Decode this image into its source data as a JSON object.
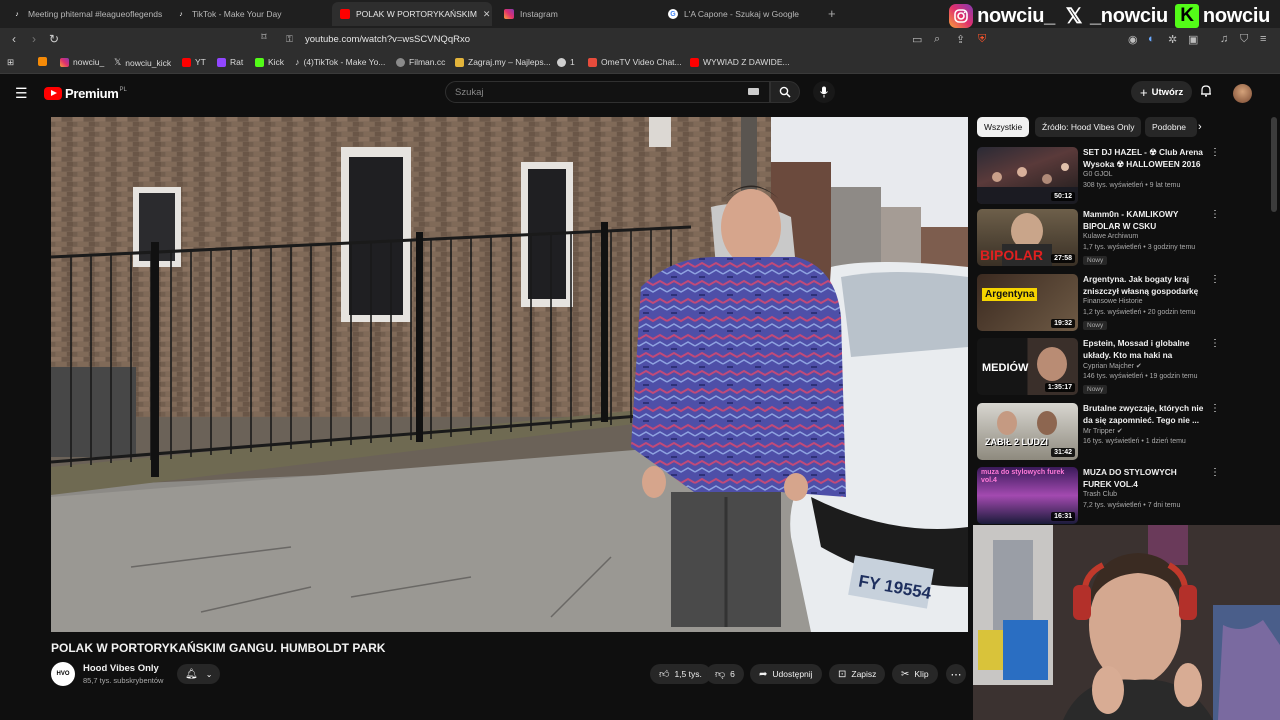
{
  "browser": {
    "tabs": [
      {
        "label": "Meeting phitemal #leagueoflegends",
        "icon": "tiktok-icon",
        "active": false
      },
      {
        "label": "TikTok - Make Your Day",
        "icon": "tiktok-icon",
        "active": false
      },
      {
        "label": "POLAK W PORTORYKAŃSKIM",
        "icon": "youtube-icon",
        "active": true
      },
      {
        "label": "Instagram",
        "icon": "instagram-icon",
        "active": false
      },
      {
        "label": "L'A Capone - Szukaj w Google",
        "icon": "google-icon",
        "active": false
      }
    ],
    "url": "youtube.com/watch?v=wsSCVNQqRxo",
    "bookmarks": [
      {
        "label": "",
        "icon": "rss-icon"
      },
      {
        "label": "nowciu_",
        "icon": "instagram-icon"
      },
      {
        "label": "nowciu_kick",
        "icon": "x-icon"
      },
      {
        "label": "YT",
        "icon": "youtube-icon"
      },
      {
        "label": "Rat",
        "icon": "twitch-icon"
      },
      {
        "label": "Kick",
        "icon": "kick-icon"
      },
      {
        "label": "(4)TikTok - Make Yo...",
        "icon": "tiktok-icon"
      },
      {
        "label": "Filman.cc",
        "icon": "globe-icon"
      },
      {
        "label": "Zagraj.my – Najleps...",
        "icon": "person-icon"
      },
      {
        "label": "1",
        "icon": "clock-icon"
      },
      {
        "label": "OmeTV Video Chat...",
        "icon": "chat-icon"
      },
      {
        "label": "WYWIAD Z DAWIDE...",
        "icon": "youtube-icon"
      }
    ]
  },
  "overlay": {
    "instagram": "nowciu_",
    "x": "_nowciu",
    "kick": "nowciu"
  },
  "youtube": {
    "logo_text": "Premium",
    "logo_region": "PL",
    "search_placeholder": "Szukaj",
    "create_label": "Utwórz",
    "video": {
      "title": "POLAK W PORTORYKAŃSKIM GANGU. HUMBOLDT PARK",
      "channel": "Hood Vibes Only",
      "subscribers": "85,7 tys. subskrybentów",
      "likes": "1,5 tys.",
      "dislikes": "6",
      "share": "Udostępnij",
      "save": "Zapisz",
      "clip": "Klip",
      "plate_text": "FY 19554"
    },
    "chips": [
      "Wszystkie",
      "Źródło: Hood Vibes Only",
      "Podobne"
    ],
    "recommendations": [
      {
        "title": "SET DJ HAZEL - ☢ Club Arena Wysoka ☢ HALLOWEEN 2016 ...",
        "channel": "G0 GJOL",
        "meta": "308 tys. wyświetleń • 9 lat temu",
        "duration": "50:12",
        "badge": "",
        "verified": false,
        "thumb_text": ""
      },
      {
        "title": "Mamm0n - KAMLIKOWY BIPOLAR W CSKU",
        "channel": "Kulawe Archiwum",
        "meta": "1,7 tys. wyświetleń • 3 godziny temu",
        "duration": "27:58",
        "badge": "Nowy",
        "verified": false,
        "thumb_text": "BIPOLAR"
      },
      {
        "title": "Argentyna. Jak bogaty kraj zniszczył własną gospodarkę",
        "channel": "Finansowe Historie",
        "meta": "1,2 tys. wyświetleń • 20 godzin temu",
        "duration": "19:32",
        "badge": "Nowy",
        "verified": false,
        "thumb_text": "Argentyna"
      },
      {
        "title": "Epstein, Mossad i globalne układy. Kto ma haki na polskie...",
        "channel": "Cyprian Majcher",
        "meta": "146 tys. wyświetleń • 19 godzin temu",
        "duration": "1:35:17",
        "badge": "Nowy",
        "verified": true,
        "thumb_text": "MEDIÓW"
      },
      {
        "title": "Brutalne zwyczaje, których nie da się zapomnieć. Tego nie ...",
        "channel": "Mr Tripper",
        "meta": "16 tys. wyświetleń • 1 dzień temu",
        "duration": "31:42",
        "badge": "",
        "verified": true,
        "thumb_text": "ZABIŁ 2 LUDZI"
      },
      {
        "title": "MUZA DO STYLOWYCH FUREK VOL.4",
        "channel": "Trash Club",
        "meta": "7,2 tys. wyświetleń • 7 dni temu",
        "duration": "16:31",
        "badge": "",
        "verified": false,
        "thumb_text": "muza do stylowych furek vol.4"
      }
    ]
  }
}
